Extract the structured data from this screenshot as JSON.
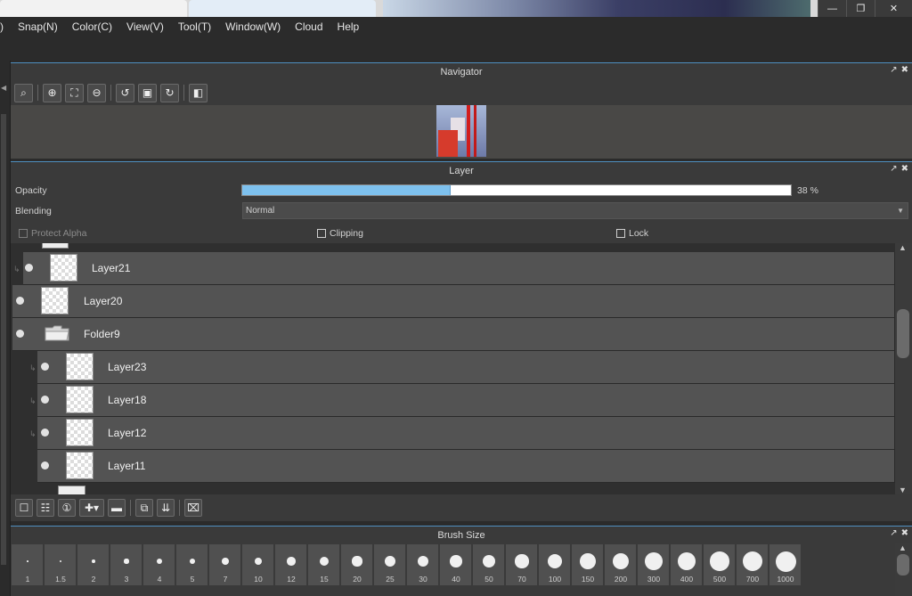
{
  "window": {
    "minimize_icon": "minimize-icon",
    "maximize_icon": "restore-icon",
    "close_icon": "close-icon"
  },
  "menu": {
    "fragment": ")",
    "items": [
      "Snap(N)",
      "Color(C)",
      "View(V)",
      "Tool(T)",
      "Window(W)",
      "Cloud",
      "Help"
    ]
  },
  "navigator": {
    "title": "Navigator",
    "tools": [
      "zoom-actual-icon",
      "zoom-in-icon",
      "fit-window-icon",
      "zoom-out-icon",
      "rotate-left-icon",
      "fit-canvas-icon",
      "rotate-right-icon",
      "flip-horizontal-icon"
    ]
  },
  "layer_panel": {
    "title": "Layer",
    "opacity_label": "Opacity",
    "opacity_value": 38,
    "opacity_text": "38 %",
    "blending_label": "Blending",
    "blending_value": "Normal",
    "protect_alpha_label": "Protect Alpha",
    "clipping_label": "Clipping",
    "lock_label": "Lock",
    "layers": [
      {
        "name": "Layer21",
        "type": "layer",
        "indent": 1
      },
      {
        "name": "Layer20",
        "type": "layer",
        "indent": 0
      },
      {
        "name": "Folder9",
        "type": "folder",
        "indent": 0
      },
      {
        "name": "Layer23",
        "type": "layer",
        "indent": 2
      },
      {
        "name": "Layer18",
        "type": "layer",
        "indent": 2
      },
      {
        "name": "Layer12",
        "type": "layer",
        "indent": 2
      },
      {
        "name": "Layer11",
        "type": "layer",
        "indent": 2
      }
    ],
    "toolbar": [
      "new-layer-icon",
      "new-halftone-layer-icon",
      "new-8bit-layer-icon",
      "add-layer-menu-icon",
      "new-folder-icon",
      "duplicate-layer-icon",
      "merge-down-icon",
      "delete-layer-icon"
    ]
  },
  "brush_size": {
    "title": "Brush Size",
    "sizes": [
      "1",
      "1.5",
      "2",
      "3",
      "4",
      "5",
      "7",
      "10",
      "12",
      "15",
      "20",
      "25",
      "30",
      "40",
      "50",
      "70",
      "100",
      "150",
      "200",
      "300",
      "400",
      "500",
      "700",
      "1000"
    ]
  }
}
